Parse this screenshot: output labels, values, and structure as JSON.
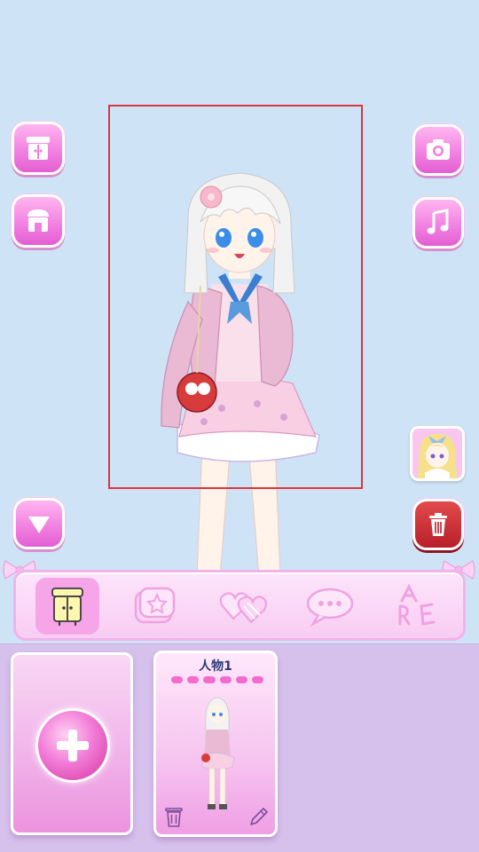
{
  "left_buttons": [
    {
      "name": "wardrobe-button",
      "icon": "wardrobe-icon"
    },
    {
      "name": "shop-button",
      "icon": "shop-icon"
    },
    {
      "name": "collapse-button",
      "icon": "triangle-down-icon"
    }
  ],
  "right_buttons": [
    {
      "name": "camera-button",
      "icon": "camera-icon"
    },
    {
      "name": "music-button",
      "icon": "music-note-icon"
    },
    {
      "name": "preset-thumbnail-button",
      "icon": "character-portrait"
    },
    {
      "name": "delete-button",
      "icon": "trash-icon"
    }
  ],
  "toolbar": {
    "tools": [
      {
        "name": "tab-wardrobe",
        "icon": "wardrobe-icon",
        "active": true
      },
      {
        "name": "tab-star-frame",
        "icon": "star-frame-icon",
        "active": false
      },
      {
        "name": "tab-hearts",
        "icon": "hearts-icon",
        "active": false
      },
      {
        "name": "tab-speech",
        "icon": "speech-bubble-icon",
        "active": false
      },
      {
        "name": "tab-letters",
        "icon": "letters-icon",
        "active": false
      }
    ]
  },
  "character_slots": [
    {
      "name": "人物1",
      "progress_dots": 6
    }
  ],
  "colors": {
    "background": "#cfe3f6",
    "accent_pink": "#f07ee0",
    "delete_red": "#b81f2a",
    "selection_frame": "#d9363e",
    "tray": "#d6c0ec"
  }
}
